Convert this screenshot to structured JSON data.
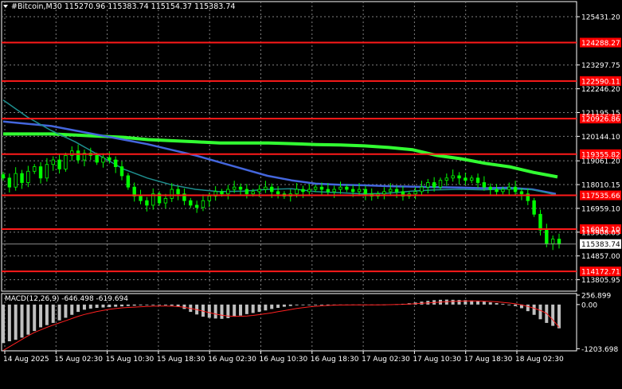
{
  "header": {
    "symbol_line": "#Bitcoin,M30  115270.96 115383.74 115154.37 115383.74",
    "dropdown_icon": "triangle-down-icon"
  },
  "colors": {
    "background": "#000000",
    "grid": "#7f7f7f",
    "candles": "#00ff00",
    "ma_green": "#32ff32",
    "ma_blue": "#4466dd",
    "ma_teal": "#1e8f8f",
    "level_lines": "#ff1a1a",
    "level_label_bg": "#ff0000",
    "current_label_bg": "#ffffff",
    "current_line": "#8a8a8a",
    "macd_hist": "#c0c0c0",
    "macd_signal": "#ff2020",
    "axis_text": "#ffffff"
  },
  "chart_data": {
    "type": "candlestick",
    "title": "#Bitcoin,M30",
    "ohlc": {
      "open": 115270.96,
      "high": 115383.74,
      "low": 115154.37,
      "close": 115383.74
    },
    "ylim": [
      113300,
      126100
    ],
    "price_ticks": [
      "125431.20",
      "123297.75",
      "122246.20",
      "121195.15",
      "120144.10",
      "119061.20",
      "118010.15",
      "116959.10",
      "115908.05",
      "114857.00",
      "113805.95"
    ],
    "current_price": "115383.74",
    "levels": [
      "124288.27",
      "122590.11",
      "120926.86",
      "119355.82",
      "117535.66",
      "116042.10",
      "114172.71"
    ],
    "time_labels": [
      "14 Aug 2025",
      "15 Aug 02:30",
      "15 Aug 10:30",
      "15 Aug 18:30",
      "16 Aug 02:30",
      "16 Aug 10:30",
      "16 Aug 18:30",
      "17 Aug 02:30",
      "17 Aug 10:30",
      "17 Aug 18:30",
      "18 Aug 02:30"
    ],
    "closes": [
      118300,
      117900,
      118500,
      118100,
      118600,
      118800,
      118300,
      118900,
      119100,
      118700,
      119300,
      119500,
      119100,
      119400,
      119300,
      119000,
      119200,
      119100,
      118800,
      118400,
      117900,
      117500,
      117300,
      117100,
      117600,
      117200,
      117400,
      117800,
      117600,
      117300,
      117100,
      117000,
      117300,
      117500,
      117700,
      117600,
      117800,
      117900,
      117800,
      117600,
      117700,
      117800,
      117900,
      117700,
      117600,
      117500,
      117600,
      117800,
      117700,
      117800,
      117900,
      117800,
      117700,
      117800,
      117900,
      117800,
      117700,
      117800,
      117600,
      117500,
      117600,
      117700,
      117800,
      117700,
      117500,
      117600,
      117700,
      117900,
      118100,
      117900,
      118200,
      118300,
      118400,
      118300,
      118200,
      118300,
      118100,
      117900,
      117800,
      117700,
      117800,
      117900,
      117700,
      117600,
      117300,
      116700,
      116000,
      115400,
      115600,
      115383.74
    ],
    "moving_averages": [
      {
        "color": "#32ff32",
        "values": [
          120250,
          120250,
          120250,
          120200,
          120150,
          120100,
          120000,
          119950,
          119900,
          119850,
          119850,
          119850,
          119820,
          119780,
          119760,
          119720,
          119650,
          119550,
          119300,
          119150,
          118950,
          118800,
          118550,
          118350
        ]
      },
      {
        "color": "#4466dd",
        "values": [
          120800,
          120700,
          120600,
          120400,
          120200,
          120000,
          119800,
          119550,
          119300,
          119000,
          118700,
          118400,
          118200,
          118050,
          118000,
          117980,
          117940,
          117920,
          117900,
          117880,
          117850,
          117870,
          117800,
          117600
        ]
      },
      {
        "color": "#1e8f8f",
        "values": [
          121750,
          121000,
          120400,
          119900,
          119300,
          118700,
          118300,
          118000,
          117800,
          117700,
          117720,
          117800,
          117830,
          117700,
          117650,
          117600,
          117630,
          117720,
          117780,
          117800,
          117780,
          117820,
          117790,
          117560
        ]
      }
    ],
    "macd": {
      "label": "MACD(12,26,9) -646.498 -619.694",
      "ylim": [
        -1260,
        300
      ],
      "ticks": [
        "256.899",
        "0.00",
        "-1203.698"
      ],
      "histogram": [
        -1050,
        -1000,
        -960,
        -900,
        -820,
        -720,
        -620,
        -560,
        -500,
        -430,
        -360,
        -280,
        -200,
        -140,
        -110,
        -90,
        -80,
        -70,
        -60,
        -50,
        -40,
        -30,
        -20,
        -15,
        -10,
        -10,
        -20,
        -30,
        -60,
        -120,
        -200,
        -270,
        -330,
        -360,
        -380,
        -390,
        -370,
        -330,
        -300,
        -260,
        -230,
        -200,
        -160,
        -120,
        -90,
        -60,
        -40,
        -20,
        -10,
        -5,
        -3,
        -2,
        0,
        -3,
        -5,
        -8,
        -10,
        -12,
        -8,
        -5,
        -3,
        0,
        5,
        10,
        20,
        35,
        55,
        80,
        100,
        120,
        130,
        135,
        130,
        125,
        120,
        110,
        100,
        80,
        60,
        40,
        20,
        0,
        -40,
        -100,
        -180,
        -280,
        -400,
        -500,
        -580,
        -646.498
      ],
      "signal": [
        -1250,
        -1150,
        -1050,
        -950,
        -850,
        -760,
        -690,
        -620,
        -560,
        -500,
        -440,
        -380,
        -320,
        -270,
        -230,
        -190,
        -160,
        -130,
        -110,
        -90,
        -80,
        -70,
        -60,
        -50,
        -45,
        -40,
        -40,
        -45,
        -55,
        -75,
        -105,
        -140,
        -180,
        -220,
        -260,
        -290,
        -310,
        -320,
        -320,
        -310,
        -295,
        -275,
        -250,
        -225,
        -195,
        -165,
        -135,
        -108,
        -85,
        -65,
        -48,
        -34,
        -24,
        -17,
        -13,
        -11,
        -10,
        -10,
        -10,
        -9,
        -8,
        -6,
        -3,
        1,
        6,
        13,
        22,
        33,
        45,
        57,
        68,
        78,
        86,
        92,
        96,
        98,
        97,
        93,
        85,
        74,
        60,
        42,
        20,
        -10,
        -50,
        -100,
        -160,
        -240,
        -420,
        -619.694
      ]
    }
  }
}
